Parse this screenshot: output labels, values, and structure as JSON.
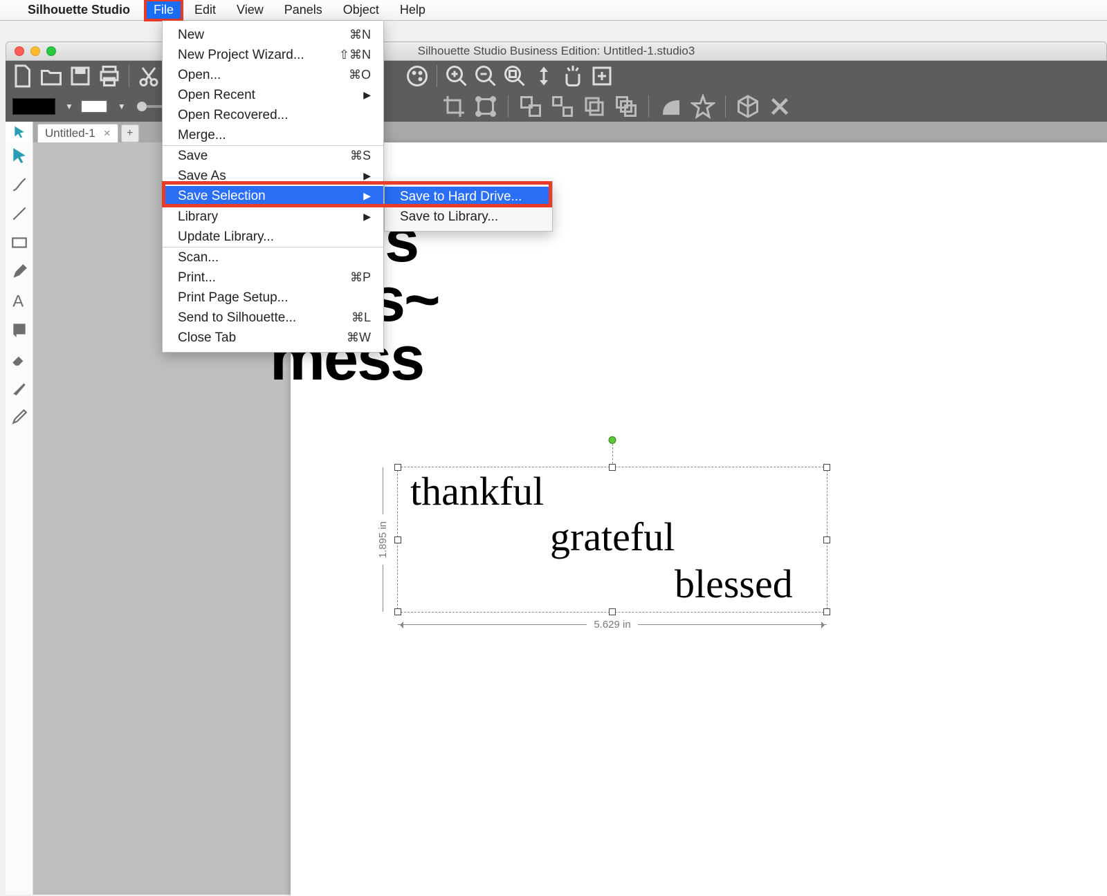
{
  "menubar": {
    "app_name": "Silhouette Studio",
    "items": [
      "File",
      "Edit",
      "View",
      "Panels",
      "Object",
      "Help"
    ],
    "highlighted": "File"
  },
  "file_menu": {
    "groups": [
      [
        {
          "label": "New",
          "shortcut": "⌘N"
        },
        {
          "label": "New Project Wizard...",
          "shortcut": "⇧⌘N"
        },
        {
          "label": "Open...",
          "shortcut": "⌘O"
        },
        {
          "label": "Open Recent",
          "submenu": true
        },
        {
          "label": "Open Recovered..."
        },
        {
          "label": "Merge..."
        }
      ],
      [
        {
          "label": "Save",
          "shortcut": "⌘S"
        },
        {
          "label": "Save As",
          "submenu": true
        },
        {
          "label": "Save Selection",
          "submenu": true,
          "selected": true
        }
      ],
      [
        {
          "label": "Library",
          "submenu": true
        },
        {
          "label": "Update Library..."
        }
      ],
      [
        {
          "label": "Scan..."
        },
        {
          "label": "Print...",
          "shortcut": "⌘P"
        },
        {
          "label": "Print Page Setup..."
        },
        {
          "label": "Send to Silhouette...",
          "shortcut": "⌘L"
        },
        {
          "label": "Close Tab",
          "shortcut": "⌘W"
        }
      ]
    ]
  },
  "save_selection_submenu": {
    "items": [
      {
        "label": "Save to Hard Drive...",
        "selected": true
      },
      {
        "label": "Save to Library..."
      }
    ]
  },
  "window": {
    "title": "Silhouette Studio Business Edition: Untitled-1.studio3"
  },
  "tabs": {
    "items": [
      {
        "label": "Untitled-1"
      }
    ]
  },
  "artwork": {
    "line1": "ess",
    "line2": "his~",
    "line3": "mess",
    "script1": "thankful",
    "script2": "grateful",
    "script3": "blessed"
  },
  "selection": {
    "width_label": "5.629 in",
    "height_label": "1.895 in"
  }
}
